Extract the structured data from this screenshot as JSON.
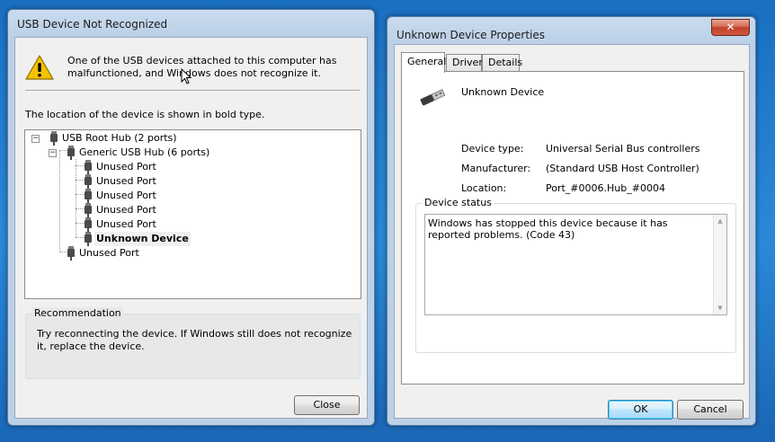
{
  "dialog1": {
    "title": "USB Device Not Recognized",
    "message": "One of the USB devices attached to this computer has malfunctioned, and Windows does not recognize it.",
    "location_text": "The location of the device is shown in bold type.",
    "tree": {
      "root": "USB Root Hub (2 ports)",
      "hub": "Generic USB Hub (6 ports)",
      "ports": [
        "Unused Port",
        "Unused Port",
        "Unused Port",
        "Unused Port",
        "Unused Port"
      ],
      "unknown": "Unknown Device",
      "root_port": "Unused Port"
    },
    "recommendation": {
      "label": "Recommendation",
      "text": "Try reconnecting the device. If Windows still does not recognize it, replace the device."
    },
    "close_label": "Close"
  },
  "dialog2": {
    "title": "Unknown Device Properties",
    "close_glyph": "✕",
    "tabs": [
      "General",
      "Driver",
      "Details"
    ],
    "device_name": "Unknown Device",
    "properties": [
      {
        "label": "Device type:",
        "value": "Universal Serial Bus controllers"
      },
      {
        "label": "Manufacturer:",
        "value": "(Standard USB Host Controller)"
      },
      {
        "label": "Location:",
        "value": "Port_#0006.Hub_#0004"
      }
    ],
    "status_label": "Device status",
    "status_text": "Windows has stopped this device because it has reported problems. (Code 43)",
    "ok_label": "OK",
    "cancel_label": "Cancel"
  },
  "colors": {
    "desktop": "#1a6fc0",
    "warning": "#f3c300",
    "close_button": "#c4402a"
  },
  "icons": {
    "warning": "warning-icon",
    "usb": "usb-connector-icon",
    "close": "close-icon"
  }
}
